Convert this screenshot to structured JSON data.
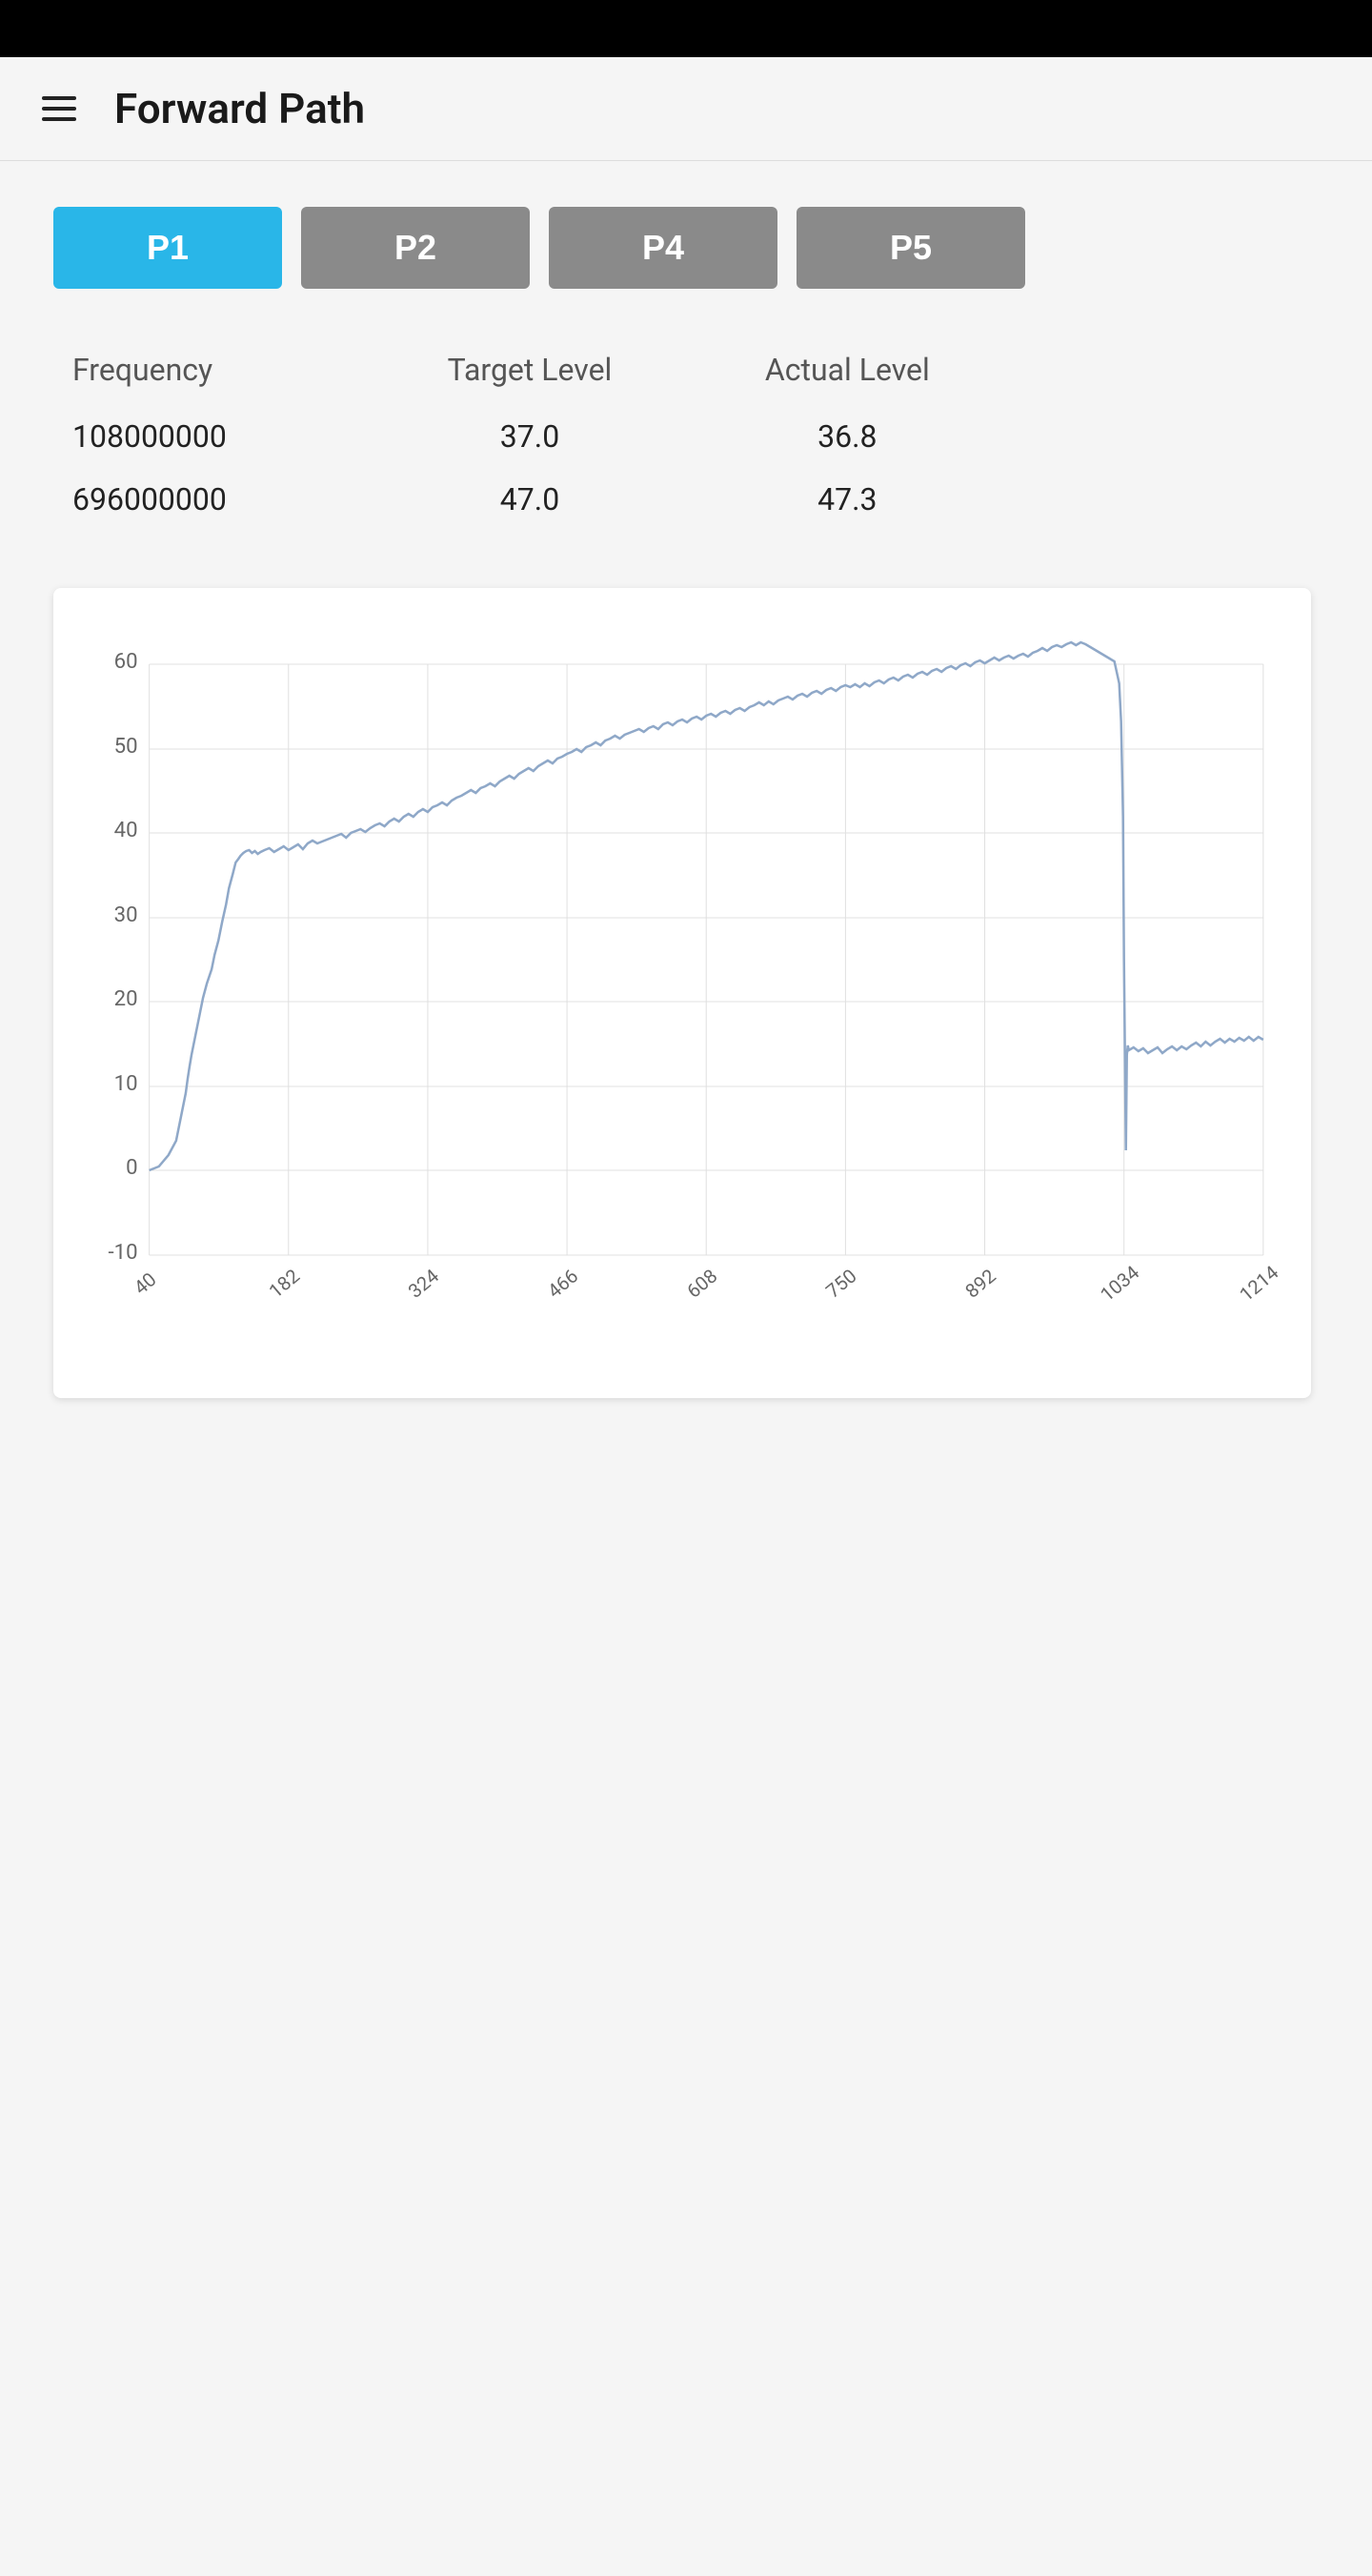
{
  "topbar": {},
  "header": {
    "menu_icon": "hamburger-icon",
    "title": "Forward Path"
  },
  "tabs": [
    {
      "label": "P1",
      "active": true
    },
    {
      "label": "P2",
      "active": false
    },
    {
      "label": "P4",
      "active": false
    },
    {
      "label": "P5",
      "active": false
    }
  ],
  "table": {
    "columns": [
      "Frequency",
      "Target Level",
      "Actual Level"
    ],
    "rows": [
      {
        "frequency": "108000000",
        "target": "37.0",
        "actual": "36.8"
      },
      {
        "frequency": "696000000",
        "target": "47.0",
        "actual": "47.3"
      }
    ]
  },
  "chart": {
    "y_labels": [
      "60",
      "50",
      "40",
      "30",
      "20",
      "10",
      "0",
      "-10"
    ],
    "x_labels": [
      "40",
      "182",
      "324",
      "466",
      "608",
      "750",
      "892",
      "1034",
      "1214"
    ]
  }
}
